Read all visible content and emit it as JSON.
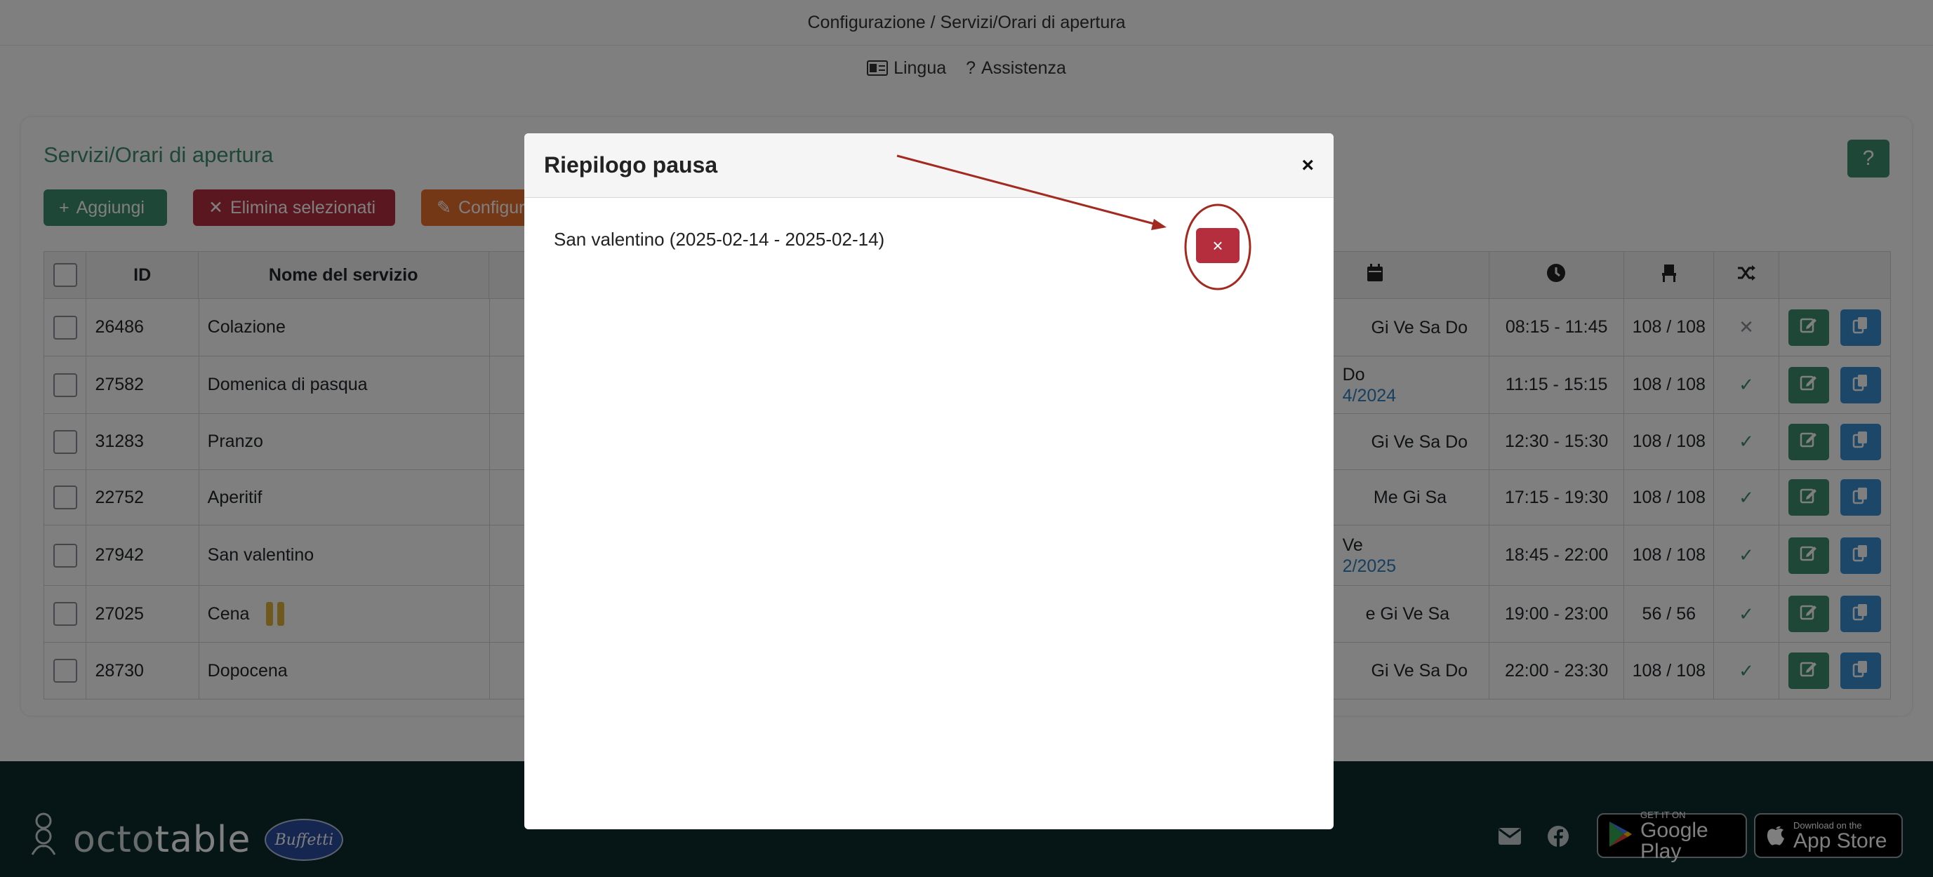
{
  "topbar": {
    "breadcrumb": "Configurazione / Servizi/Orari di apertura"
  },
  "subbar": {
    "language_label": "Lingua",
    "help_label": "Assistenza"
  },
  "card": {
    "title": "Servizi/Orari di apertura",
    "help_button": "?",
    "buttons": {
      "add": "Aggiungi",
      "delete_selected": "Elimina selezionati",
      "configure": "Configur"
    }
  },
  "table": {
    "headers": {
      "id": "ID",
      "name": "Nome del servizio"
    },
    "rows": [
      {
        "id": "26486",
        "name": "Colazione",
        "days": "Gi Ve Sa Do",
        "date": "",
        "time": "08:15 - 11:45",
        "capacity": "108 / 108",
        "mix": "cross"
      },
      {
        "id": "27582",
        "name": "Domenica di pasqua",
        "days": "Do",
        "date": "4/2024",
        "time": "11:15 - 15:15",
        "capacity": "108 / 108",
        "mix": "check"
      },
      {
        "id": "31283",
        "name": "Pranzo",
        "days": "Gi Ve Sa Do",
        "date": "",
        "time": "12:30 - 15:30",
        "capacity": "108 / 108",
        "mix": "check"
      },
      {
        "id": "22752",
        "name": "Aperitif",
        "days": "Me Gi Sa",
        "date": "",
        "time": "17:15 - 19:30",
        "capacity": "108 / 108",
        "mix": "check"
      },
      {
        "id": "27942",
        "name": "San valentino",
        "days": "Ve",
        "date": "2/2025",
        "time": "18:45 - 22:00",
        "capacity": "108 / 108",
        "mix": "check"
      },
      {
        "id": "27025",
        "name": "Cena",
        "days": "e Gi Ve Sa",
        "date": "",
        "time": "19:00 - 23:00",
        "capacity": "56 / 56",
        "mix": "check"
      },
      {
        "id": "28730",
        "name": "Dopocena",
        "days": "Gi Ve Sa Do",
        "date": "",
        "time": "22:00 - 23:30",
        "capacity": "108 / 108",
        "mix": "check"
      }
    ]
  },
  "modal": {
    "title": "Riepilogo pausa",
    "close": "×",
    "pause_entry": "San valentino (2025-02-14 - 2025-02-14)",
    "delete_button": "×"
  },
  "footer": {
    "logo_octo": "octo",
    "logo_table": "table",
    "partner_logo": "Buffetti",
    "google_play": {
      "small": "GET IT ON",
      "big": "Google Play"
    },
    "app_store": {
      "small": "Download on the",
      "big": "App Store"
    }
  },
  "colors": {
    "green": "#3d8f6e",
    "red": "#b52e3e",
    "orange": "#e8712d",
    "blue": "#3b8ed1",
    "annotation": "#a32a20"
  }
}
